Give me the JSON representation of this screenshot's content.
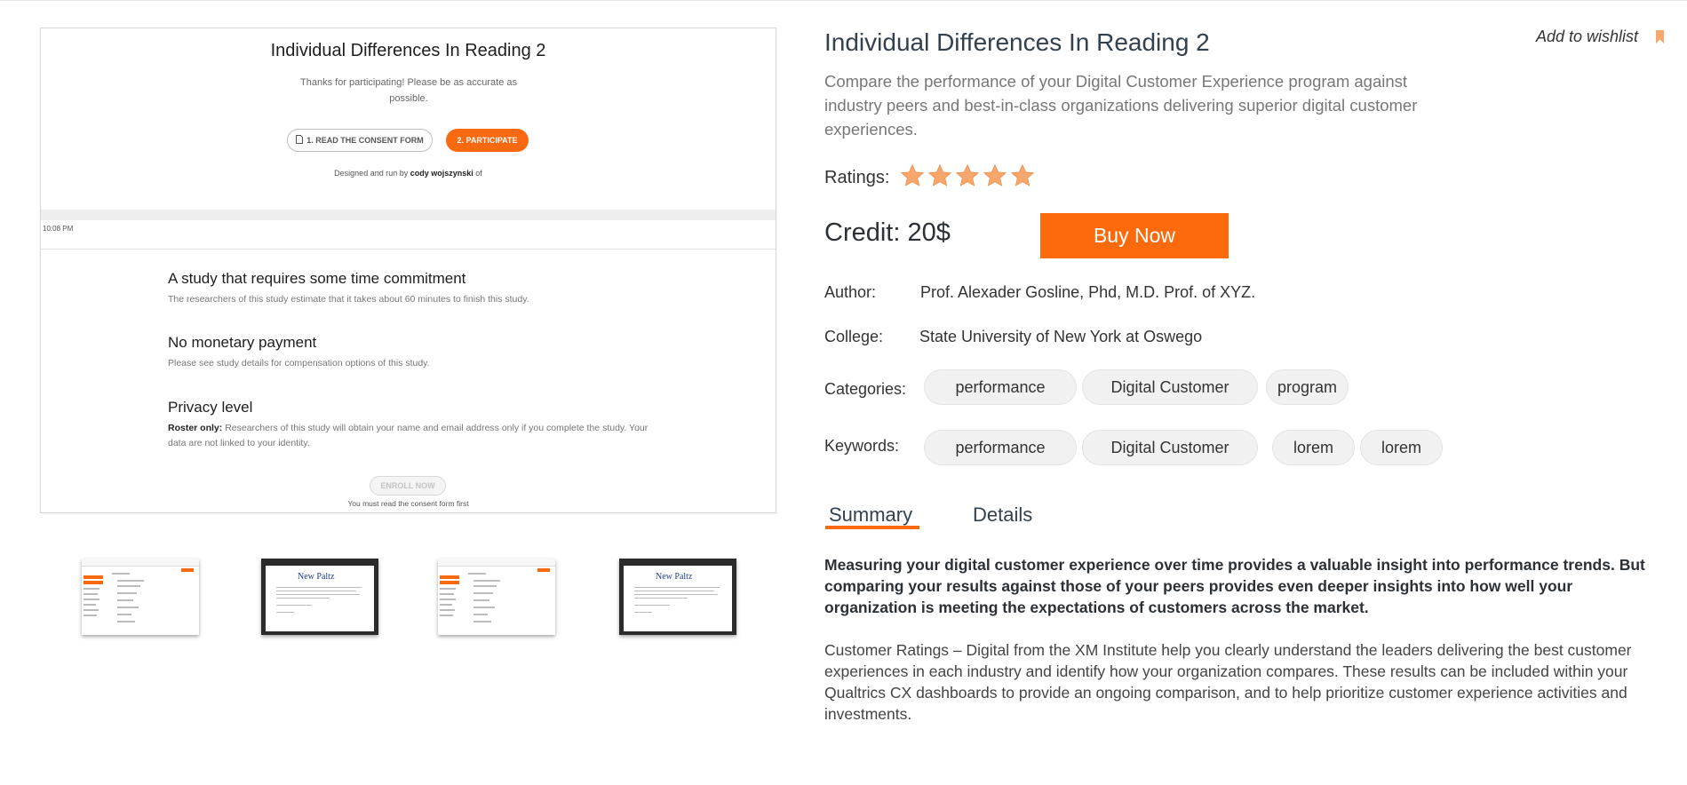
{
  "preview": {
    "title": "Individual Differences In Reading 2",
    "thanks": "Thanks for participating! Please be as accurate as possible.",
    "consent_button": "1. READ THE CONSENT FORM",
    "participate_button": "2. PARTICIPATE",
    "designed_prefix": "Designed and run by",
    "designed_name": "cody wojszynski",
    "designed_suffix": "of",
    "time": "10:08 PM",
    "sections": [
      {
        "heading": "A study that requires some time commitment",
        "text": "The researchers of this study estimate that it takes about 60 minutes to finish this study."
      },
      {
        "heading": "No monetary payment",
        "text": "Please see study details for compensation options of this study."
      },
      {
        "heading": "Privacy level",
        "bold": "Roster only:",
        "text": "Researchers of this study will obtain your name and email address only if you complete the study. Your data are not linked to your identity."
      }
    ],
    "enroll_button": "ENROLL NOW",
    "must_read": "You must read the consent form first"
  },
  "thumbnails": {
    "logo_text": "New Paltz"
  },
  "product": {
    "title": "Individual Differences In Reading 2",
    "wishlist": "Add to wishlist",
    "description": "Compare the performance of your Digital Customer Experience program against industry peers and best-in-class organizations delivering superior digital customer experiences.",
    "ratings_label": "Ratings:",
    "rating": 5,
    "credit": "Credit: 20$",
    "buy_button": "Buy Now",
    "author_label": "Author:",
    "author": "Prof. Alexader Gosline, Phd, M.D. Prof. of XYZ.",
    "college_label": "College:",
    "college": "State University of New York at Oswego",
    "categories_label": "Categories:",
    "categories": [
      "performance",
      "Digital Customer",
      "program"
    ],
    "keywords_label": "Keywords:",
    "keywords": [
      "performance",
      "Digital Customer",
      "lorem",
      "lorem"
    ],
    "tabs": [
      "Summary",
      "Details"
    ],
    "summary_bold": "Measuring your digital customer experience over time provides a valuable insight into performance trends.  But comparing your results against those of your peers provides even deeper insights into how well your organization is meeting the expectations of customers across the market.",
    "summary_text": "Customer Ratings – Digital from the XM Institute help you clearly understand the leaders delivering the best customer experiences in each industry and identify how your organization compares.  These results can be included within your Qualtrics CX dashboards to provide an ongoing comparison, and to help prioritize customer experience activities and investments."
  },
  "colors": {
    "accent": "#fd6a0c",
    "star": "#f7a66c",
    "chip_bg": "#f1f1f1"
  }
}
